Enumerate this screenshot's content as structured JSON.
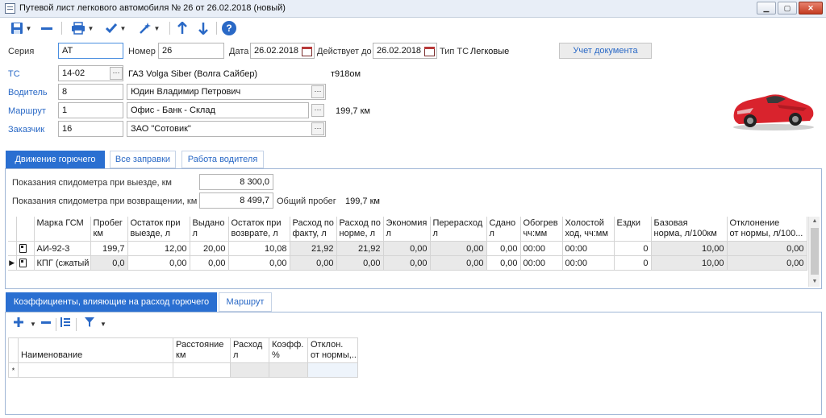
{
  "window": {
    "title": "Путевой лист легкового автомобиля № 26 от 26.02.2018 (новый)",
    "min": "▁",
    "max": "▢",
    "close": "✕"
  },
  "toolbar": {
    "save_icon": "floppy-disk-icon",
    "remove_icon": "minus-icon",
    "print_icon": "printer-icon",
    "approve_icon": "checkmark-icon",
    "wand_icon": "magic-wand-icon",
    "up_icon": "arrow-up-icon",
    "down_icon": "arrow-down-icon",
    "help_label": "?"
  },
  "form": {
    "series_label": "Серия",
    "series_value": "АТ",
    "number_label": "Номер",
    "number_value": "26",
    "date_label": "Дата",
    "date_value": "26.02.2018",
    "valid_label": "Действует до",
    "valid_value": "26.02.2018",
    "type_label": "Тип ТС",
    "type_value": "Легковые",
    "account_button": "Учет документа",
    "vehicle_label": "ТС",
    "vehicle_code": "14-02",
    "vehicle_name": "ГАЗ Volga Siber (Волга Сайбер)",
    "vehicle_plate": "т918ом",
    "driver_label": "Водитель",
    "driver_code": "8",
    "driver_name": "Юдин Владимир Петрович",
    "route_label": "Маршрут",
    "route_code": "1",
    "route_name": "Офис - Банк - Склад",
    "route_distance": "199,7 км",
    "customer_label": "Заказчик",
    "customer_code": "16",
    "customer_name": "ЗАО \"Сотовик\"",
    "ellipsis": "···"
  },
  "tabs_top": [
    "Движение горючего",
    "Все заправки",
    "Работа водителя"
  ],
  "fuel": {
    "odometer_out_label": "Показания спидометра при выезде, км",
    "odometer_out_value": "8 300,0",
    "odometer_in_label": "Показания спидометра при возвращении, км",
    "odometer_in_value": "8 499,7",
    "total_label": "Общий пробег",
    "total_value": "199,7 км"
  },
  "fuel_table": {
    "headers": [
      [
        "Марка ГСМ",
        ""
      ],
      [
        "Пробег",
        "км"
      ],
      [
        "Остаток при",
        "выезде, л"
      ],
      [
        "Выдано",
        "л"
      ],
      [
        "Остаток при",
        "возврате, л"
      ],
      [
        "Расход по",
        "факту, л"
      ],
      [
        "Расход по",
        "норме, л"
      ],
      [
        "Экономия",
        "л"
      ],
      [
        "Перерасход",
        "л"
      ],
      [
        "Сдано",
        "л"
      ],
      [
        "Обогрев",
        "чч:мм"
      ],
      [
        "Холостой",
        "ход, чч:мм"
      ],
      [
        "Ездки",
        ""
      ],
      [
        "Базовая",
        "норма, л/100км"
      ],
      [
        "Отклонение",
        "от нормы, л/100..."
      ]
    ],
    "rows": [
      [
        "АИ-92-3",
        "199,7",
        "12,00",
        "20,00",
        "10,08",
        "21,92",
        "21,92",
        "0,00",
        "0,00",
        "0,00",
        "00:00",
        "00:00",
        "0",
        "10,00",
        "0,00"
      ],
      [
        "КПГ (сжатый",
        "0,0",
        "0,00",
        "0,00",
        "0,00",
        "0,00",
        "0,00",
        "0,00",
        "0,00",
        "0,00",
        "00:00",
        "00:00",
        "0",
        "10,00",
        "0,00"
      ]
    ]
  },
  "tabs_bottom": [
    "Коэффициенты, влияющие на расход горючего",
    "Маршрут"
  ],
  "coef_toolbar": {
    "add_icon": "plus-icon",
    "remove_icon": "minus-icon",
    "list_icon": "list-icon",
    "filter_icon": "filter-icon"
  },
  "coef_table": {
    "headers": [
      [
        "Наименование",
        ""
      ],
      [
        "Расстояние",
        "км"
      ],
      [
        "Расход",
        "л"
      ],
      [
        "Коэфф.",
        "%"
      ],
      [
        "Отклон.",
        "от нормы,..."
      ]
    ],
    "new_row_marker": "*"
  },
  "colors": {
    "accent": "#2a6fd1",
    "link": "#2a69c6",
    "car": "#d9232d"
  }
}
